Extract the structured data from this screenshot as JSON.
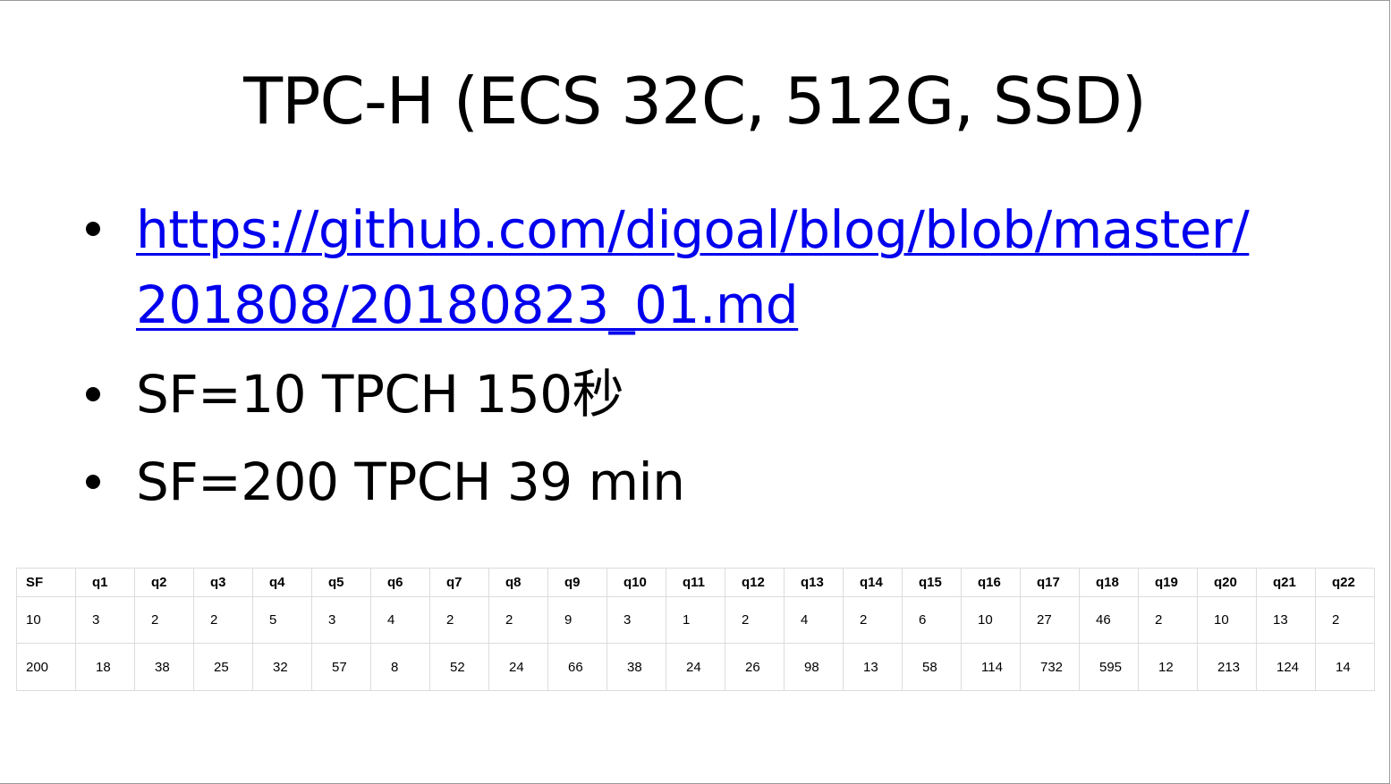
{
  "slide": {
    "title": "TPC-H (ECS 32C, 512G, SSD)",
    "bullets": {
      "link_line1": "https://github.com/digoal/blog/blob/master/",
      "link_line2": "201808/20180823_01.md",
      "sf10": "SF=10 TPCH 150秒",
      "sf200": "SF=200 TPCH 39 min"
    },
    "table": {
      "header": [
        "SF",
        "q1",
        "q2",
        "q3",
        "q4",
        "q5",
        "q6",
        "q7",
        "q8",
        "q9",
        "q10",
        "q11",
        "q12",
        "q13",
        "q14",
        "q15",
        "q16",
        "q17",
        "q18",
        "q19",
        "q20",
        "q21",
        "q22"
      ],
      "rows": [
        [
          "10",
          "3",
          "2",
          "2",
          "5",
          "3",
          "4",
          "2",
          "2",
          "9",
          "3",
          "1",
          "2",
          "4",
          "2",
          "6",
          "10",
          "27",
          "46",
          "2",
          "10",
          "13",
          "2"
        ],
        [
          "200",
          "18",
          "38",
          "25",
          "32",
          "57",
          "8",
          "52",
          "24",
          "66",
          "38",
          "24",
          "26",
          "98",
          "13",
          "58",
          "114",
          "732",
          "595",
          "12",
          "213",
          "124",
          "14"
        ]
      ]
    }
  }
}
